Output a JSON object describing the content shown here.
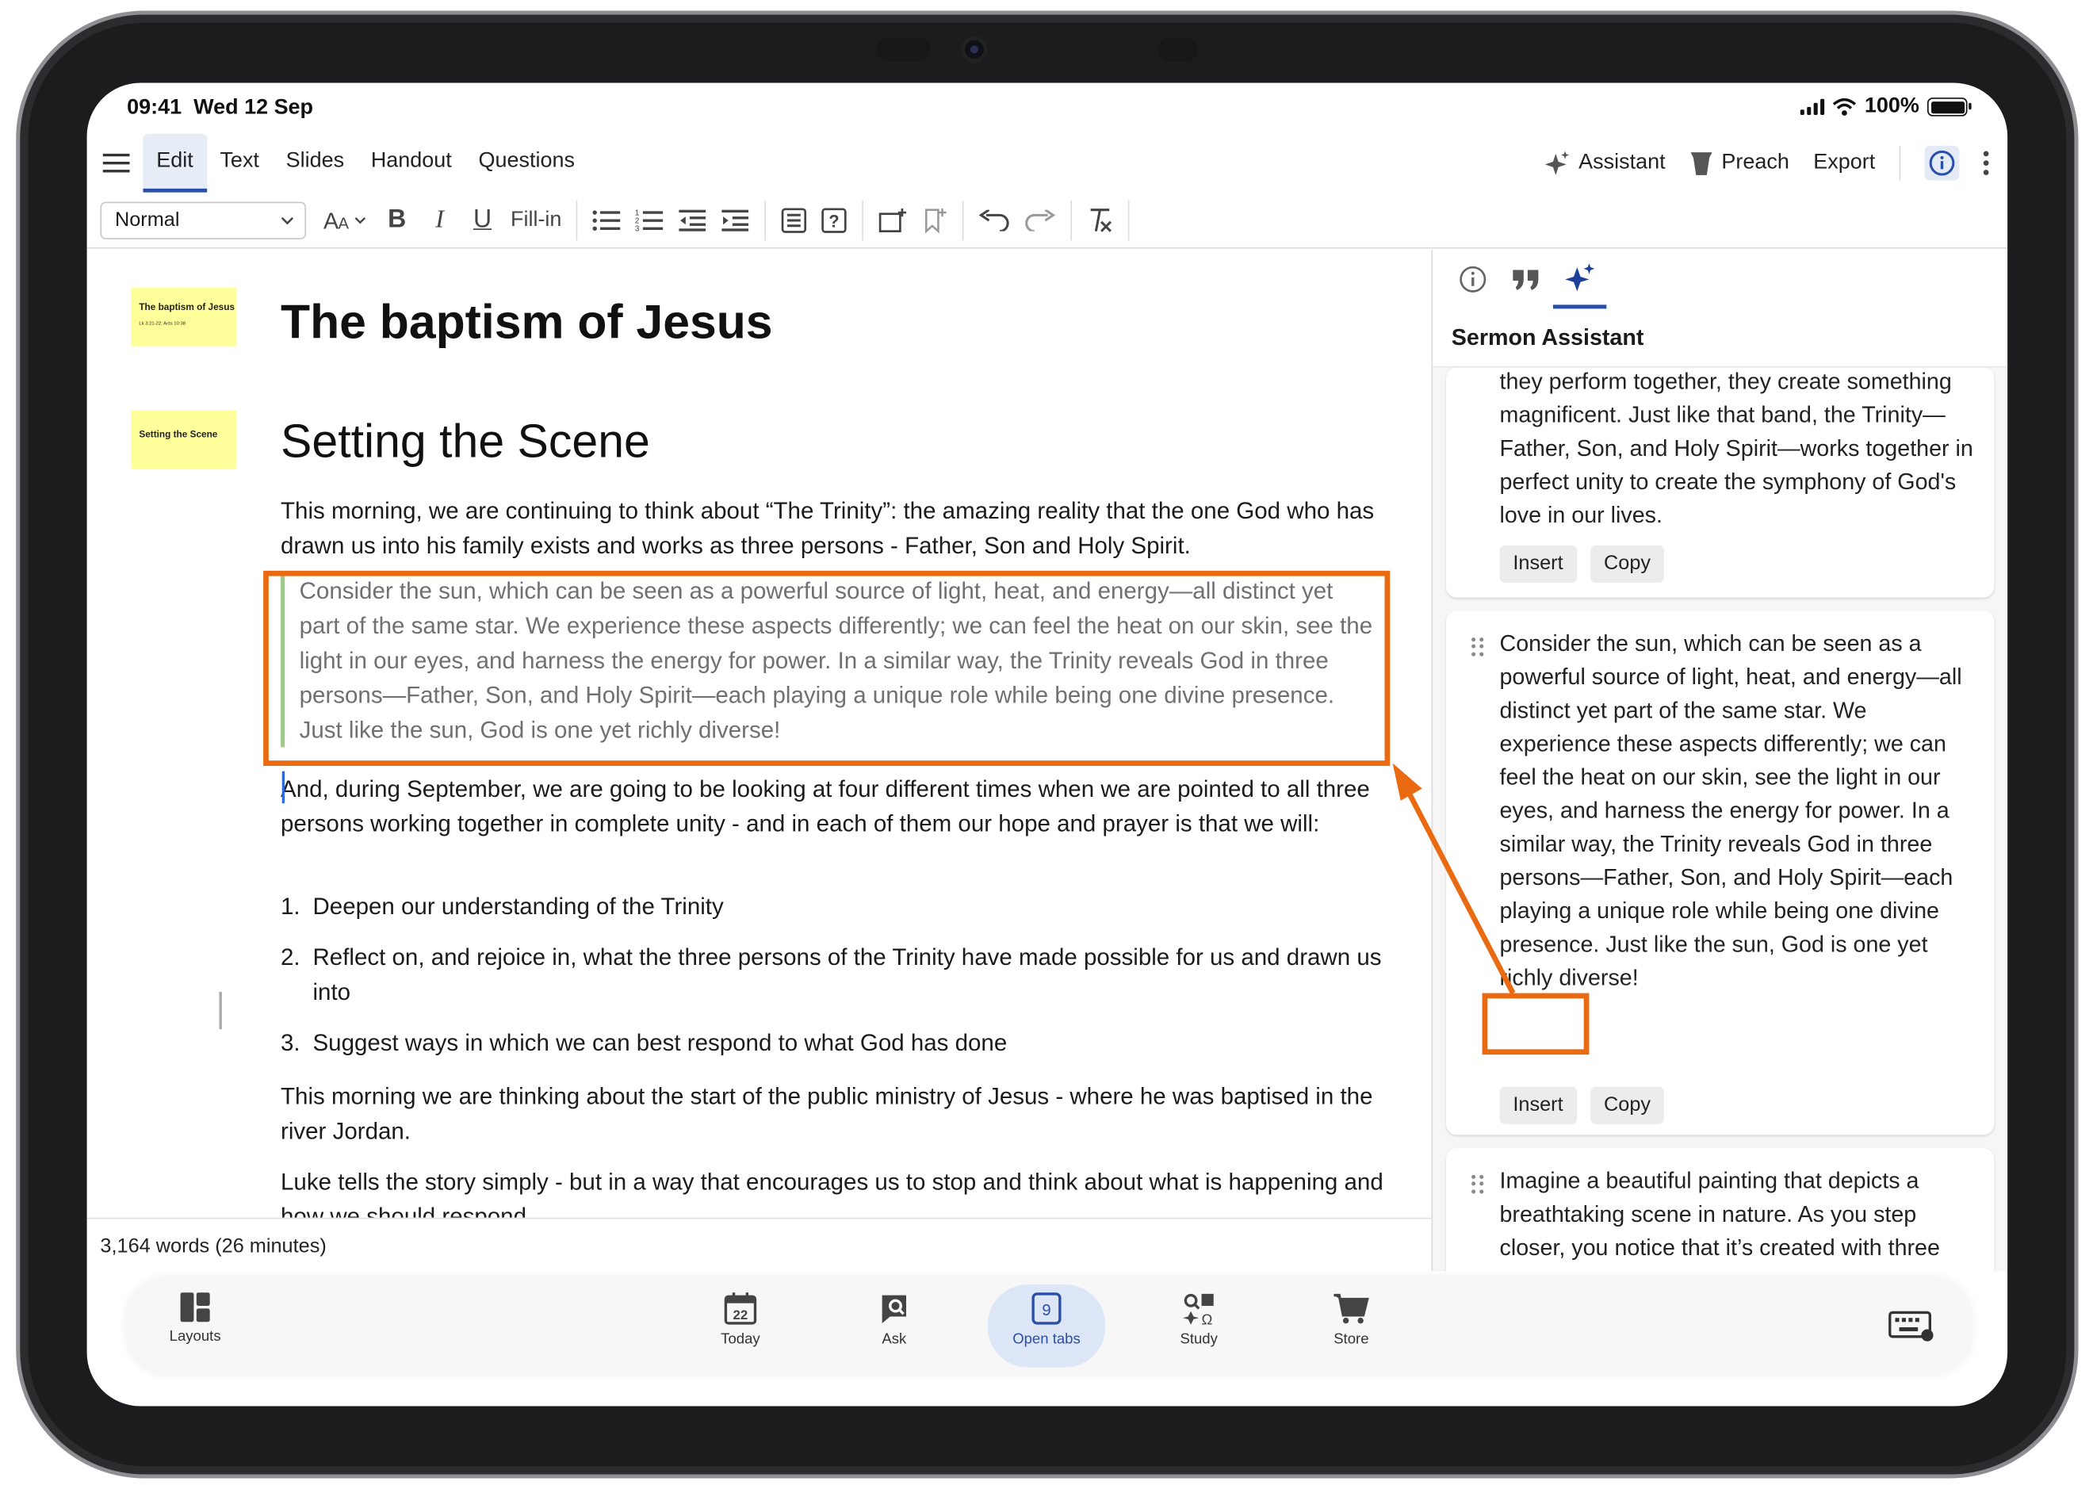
{
  "status": {
    "time": "09:41",
    "date": "Wed 12 Sep",
    "battery": "100%"
  },
  "menu": {
    "tabs": [
      "Edit",
      "Text",
      "Slides",
      "Handout",
      "Questions"
    ],
    "active_tab": "Edit",
    "assistant": "Assistant",
    "preach": "Preach",
    "export": "Export"
  },
  "toolbar": {
    "style_value": "Normal",
    "fill_in": "Fill-in"
  },
  "slides": {
    "thumb1_title": "The baptism of Jesus",
    "thumb1_sub": "Lk 3:21-22; Acts 10:38",
    "thumb2_title": "Setting the Scene"
  },
  "document": {
    "title": "The baptism of Jesus",
    "heading": "Setting the Scene",
    "para1": "This morning, we are continuing to think about “The Trinity”: the amazing reality that the one God who has drawn us into his family exists and works as three persons - Father, Son and Holy Spirit.",
    "quote": "Consider the sun, which can be seen as a powerful source of light, heat, and energy—all distinct yet part of the same star. We experience these aspects differently; we can feel the heat on our skin, see the light in our eyes, and harness the energy for power. In a similar way, the Trinity reveals God in three persons—Father, Son, and Holy Spirit—each playing a unique role while being one divine presence. Just like the sun, God is one yet richly diverse!",
    "para2": "And, during September, we are going to be looking at four different times when we are pointed to all three persons working together in complete unity - and in each of them our hope and prayer is that we will:",
    "list": [
      {
        "n": "1.",
        "text": "Deepen our understanding of the Trinity"
      },
      {
        "n": "2.",
        "text": "Reflect on, and rejoice in, what the three persons of the Trinity have made possible for us and drawn us into"
      },
      {
        "n": "3.",
        "text": "Suggest ways in which we can best respond to what God has done"
      }
    ],
    "para3": "This morning we are thinking about the start of the public ministry of Jesus - where he was  baptised in the river Jordan.",
    "para4": "Luke tells the story simply - but in a way that encourages us to stop and think about what is happening and how we should respond.",
    "word_count": "3,164 words (26 minutes)"
  },
  "assistant_panel": {
    "title": "Sermon Assistant",
    "cards": [
      {
        "text": "they perform together, they create something magnificent. Just like that band, the Trinity—Father, Son, and Holy Spirit—works together in perfect unity to create the symphony of God's love in our lives.",
        "insert": "Insert",
        "copy": "Copy"
      },
      {
        "text": "Consider the sun, which can be seen as a powerful source of light, heat, and energy—all distinct yet part of the same star. We experience these aspects differently; we can feel the heat on our skin, see the light in our eyes, and harness the energy for power. In a similar way, the Trinity reveals God in three persons—Father, Son, and Holy Spirit—each playing a unique role while being one divine presence. Just like the sun, God is one yet richly diverse!",
        "insert": "Insert",
        "copy": "Copy"
      },
      {
        "text": "Imagine a beautiful painting that depicts a breathtaking scene in nature. As you step closer, you notice that it’s created with three different brushes—each having its own technique and style. Together, they form a stunning masterpiece. This is like the Trinity!"
      }
    ]
  },
  "tabbar": {
    "layouts": "Layouts",
    "today": "Today",
    "today_day": "22",
    "ask": "Ask",
    "open_tabs": "Open tabs",
    "open_tabs_count": "9",
    "study": "Study",
    "store": "Store"
  },
  "colors": {
    "highlight": "#ea6a12",
    "accent": "#2a4fa8",
    "slide_thumb": "#fefe9a",
    "quote_bar": "#9fc98e"
  },
  "icons": [
    "hamburger-icon",
    "assistant-sparkle-icon",
    "pulpit-icon",
    "info-icon",
    "more-icon",
    "bold-icon",
    "italic-icon",
    "underline-icon",
    "undo-icon",
    "redo-icon",
    "clear-format-icon",
    "quote-icon",
    "layouts-icon",
    "calendar-icon",
    "ask-icon",
    "study-icon",
    "store-cart-icon",
    "keyboard-icon"
  ]
}
